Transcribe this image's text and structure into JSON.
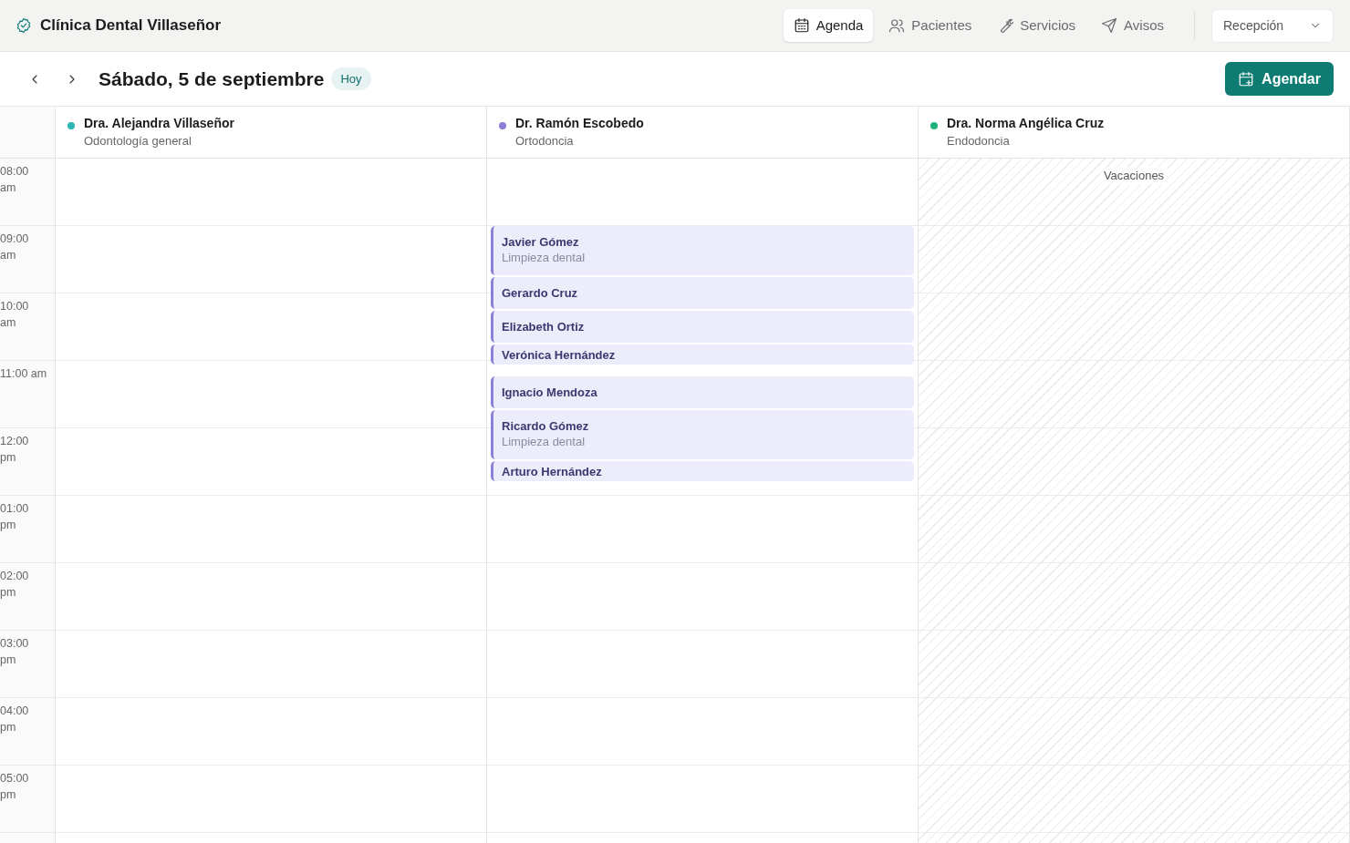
{
  "app": {
    "title": "Clínica Dental Villaseñor"
  },
  "nav": [
    {
      "label": "Agenda",
      "selected": true
    },
    {
      "label": "Pacientes",
      "selected": false
    },
    {
      "label": "Servicios",
      "selected": false
    },
    {
      "label": "Avisos",
      "selected": false
    }
  ],
  "role_select": {
    "value": "Recepción"
  },
  "date_bar": {
    "date": "Sábado, 5 de septiembre",
    "today_badge": "Hoy",
    "action": "Agendar"
  },
  "times": [
    "08:00 am",
    "09:00 am",
    "10:00 am",
    "11:00 am",
    "12:00 pm",
    "01:00 pm",
    "02:00 pm",
    "03:00 pm",
    "04:00 pm",
    "05:00 pm"
  ],
  "doctors": [
    {
      "name": "Dra. Alejandra Villaseñor",
      "specialty": "Odontología general",
      "color": "#2bb5b0"
    },
    {
      "name": "Dr. Ramón Escobedo",
      "specialty": "Ortodoncia",
      "color": "#8b7fd6",
      "appointment_groups": [
        {
          "appointments": [
            {
              "patient": "Javier Gómez",
              "service": "Limpieza dental"
            },
            {
              "patient": "Gerardo Cruz"
            },
            {
              "patient": "Elizabeth Ortiz"
            },
            {
              "patient": "Verónica Hernández"
            }
          ]
        },
        {
          "appointments": [
            {
              "patient": "Ignacio Mendoza"
            },
            {
              "patient": "Ricardo Gómez",
              "service": "Limpieza dental"
            },
            {
              "patient": "Arturo Hernández"
            }
          ]
        }
      ]
    },
    {
      "name": "Dra. Norma Angélica Cruz",
      "specialty": "Endodoncia",
      "color": "#22b07a",
      "unavailable": "Vacaciones"
    }
  ]
}
